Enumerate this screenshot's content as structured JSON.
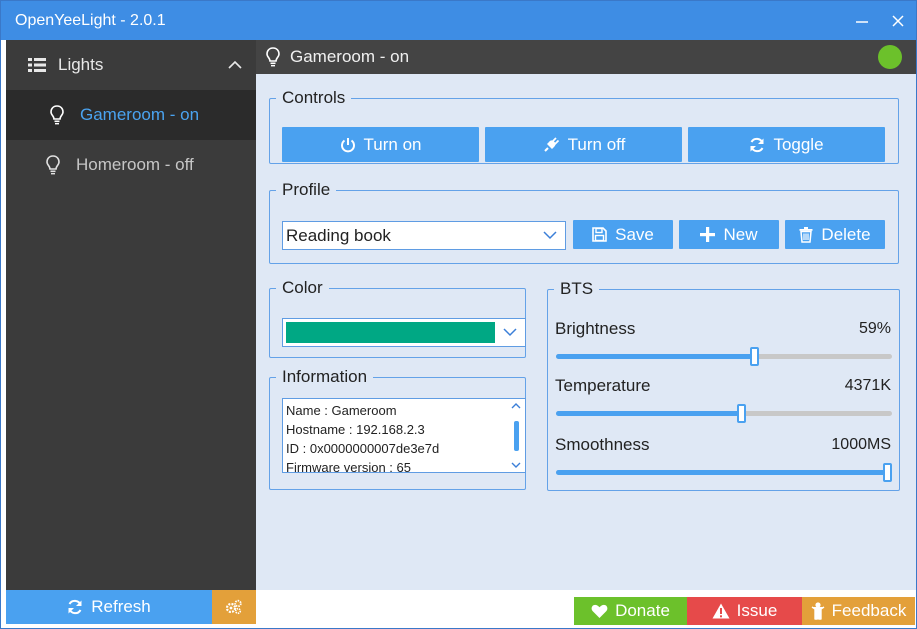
{
  "window": {
    "title": "OpenYeeLight - 2.0.1"
  },
  "sidebar": {
    "header": "Lights",
    "items": [
      {
        "label": "Gameroom - on",
        "active": true
      },
      {
        "label": "Homeroom - off",
        "active": false
      }
    ],
    "refresh_label": "Refresh"
  },
  "main": {
    "header_label": "Gameroom - on",
    "status_color": "#6cc12b",
    "controls": {
      "legend": "Controls",
      "turn_on": "Turn on",
      "turn_off": "Turn off",
      "toggle": "Toggle"
    },
    "profile": {
      "legend": "Profile",
      "selected": "Reading book",
      "save": "Save",
      "new": "New",
      "delete": "Delete"
    },
    "color": {
      "legend": "Color",
      "value": "#00a884"
    },
    "information": {
      "legend": "Information",
      "lines": [
        "Name : Gameroom",
        "Hostname : 192.168.2.3",
        "ID : 0x0000000007de3e7d",
        "Firmware version : 65"
      ]
    },
    "bts": {
      "legend": "BTS",
      "brightness": {
        "label": "Brightness",
        "value_text": "59%",
        "level": 0.59
      },
      "temperature": {
        "label": "Temperature",
        "value_text": "4371K",
        "level": 0.55
      },
      "smoothness": {
        "label": "Smoothness",
        "value_text": "1000MS",
        "level": 1.0
      }
    }
  },
  "footer": {
    "donate": "Donate",
    "issue": "Issue",
    "feedback": "Feedback"
  },
  "colors": {
    "accent": "#4aa1f0",
    "titlebar": "#3e8de4",
    "donate": "#6cc12b",
    "issue": "#e64a4a",
    "feedback": "#e3a03a"
  }
}
